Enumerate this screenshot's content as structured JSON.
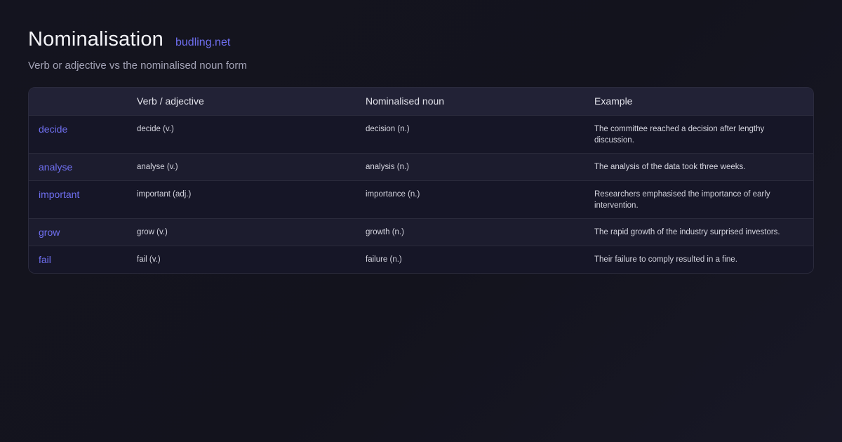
{
  "header": {
    "title": "Nominalisation",
    "brand": "budling.net",
    "subtitle": "Verb or adjective vs the nominalised noun form"
  },
  "table": {
    "columns": [
      "",
      "Verb / adjective",
      "Nominalised noun",
      "Example"
    ],
    "rows": [
      {
        "word": "decide",
        "verb": "decide (v.)",
        "noun": "decision (n.)",
        "example": "The committee reached a decision after lengthy discussion."
      },
      {
        "word": "analyse",
        "verb": "analyse (v.)",
        "noun": "analysis (n.)",
        "example": "The analysis of the data took three weeks."
      },
      {
        "word": "important",
        "verb": "important (adj.)",
        "noun": "importance (n.)",
        "example": "Researchers emphasised the importance of early intervention."
      },
      {
        "word": "grow",
        "verb": "grow (v.)",
        "noun": "growth (n.)",
        "example": "The rapid growth of the industry surprised investors."
      },
      {
        "word": "fail",
        "verb": "fail (v.)",
        "noun": "failure (n.)",
        "example": "Their failure to comply resulted in a fine."
      }
    ]
  },
  "colors": {
    "accent": "#6f6ff0",
    "background": "#14141f",
    "header_row": "#222236"
  }
}
